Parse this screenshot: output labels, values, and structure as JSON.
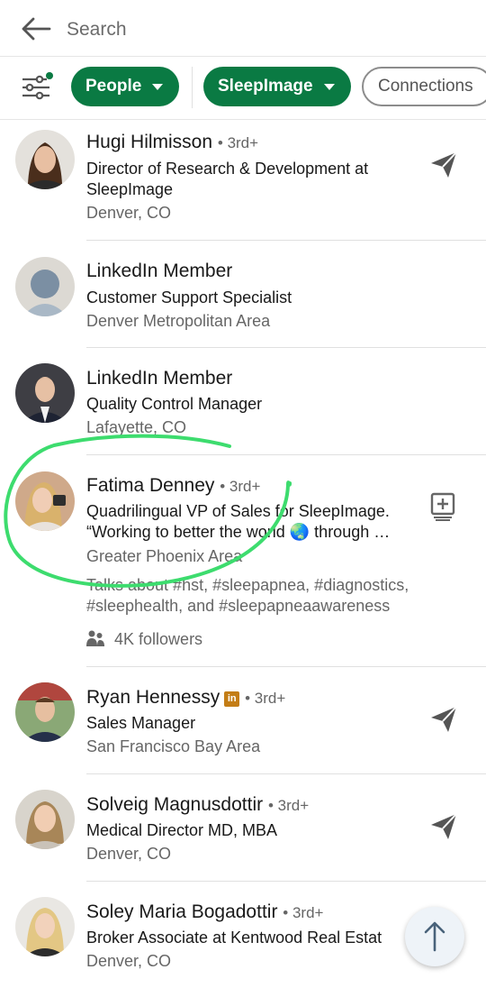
{
  "search": {
    "placeholder": "Search"
  },
  "filters": {
    "people_label": "People",
    "company_label": "SleepImage",
    "connections_label": "Connections"
  },
  "colors": {
    "brand_green": "#0a7a43",
    "annotation_green": "#3ddc6e",
    "premium_badge": "#c37d16"
  },
  "results": [
    {
      "name": "Hugi Hilmisson",
      "degree": "• 3rd+",
      "headline1": "Director of Research & Development at",
      "headline2": "SleepImage",
      "location": "Denver, CO",
      "action": "send-icon"
    },
    {
      "name": "LinkedIn Member",
      "degree": "",
      "headline1": "Customer Support Specialist",
      "location": "Denver Metropolitan Area"
    },
    {
      "name": "LinkedIn Member",
      "degree": "",
      "headline1": "Quality Control Manager",
      "location": "Lafayette, CO"
    },
    {
      "name": "Fatima Denney",
      "degree": "• 3rd+",
      "headline1": "Quadrilingual VP of Sales for SleepImage.",
      "headline2": "“Working to better the world 🌏 through …",
      "location": "Greater Phoenix Area",
      "talks1": "Talks about #hst, #sleepapnea, #diagnostics,",
      "talks2": "#sleephealth, and #sleepapneaawareness",
      "followers": "4K followers",
      "action": "follow-icon"
    },
    {
      "name": "Ryan Hennessy",
      "badge": "in",
      "degree": "• 3rd+",
      "headline1": "Sales Manager",
      "location": "San Francisco Bay Area",
      "action": "send-icon"
    },
    {
      "name": "Solveig Magnusdottir",
      "degree": "• 3rd+",
      "headline1": "Medical Director MD, MBA",
      "location": "Denver, CO",
      "action": "send-icon"
    },
    {
      "name": "Soley Maria Bogadottir",
      "degree": "• 3rd+",
      "headline1": "Broker Associate at Kentwood Real Estat",
      "location": "Denver, CO"
    }
  ]
}
